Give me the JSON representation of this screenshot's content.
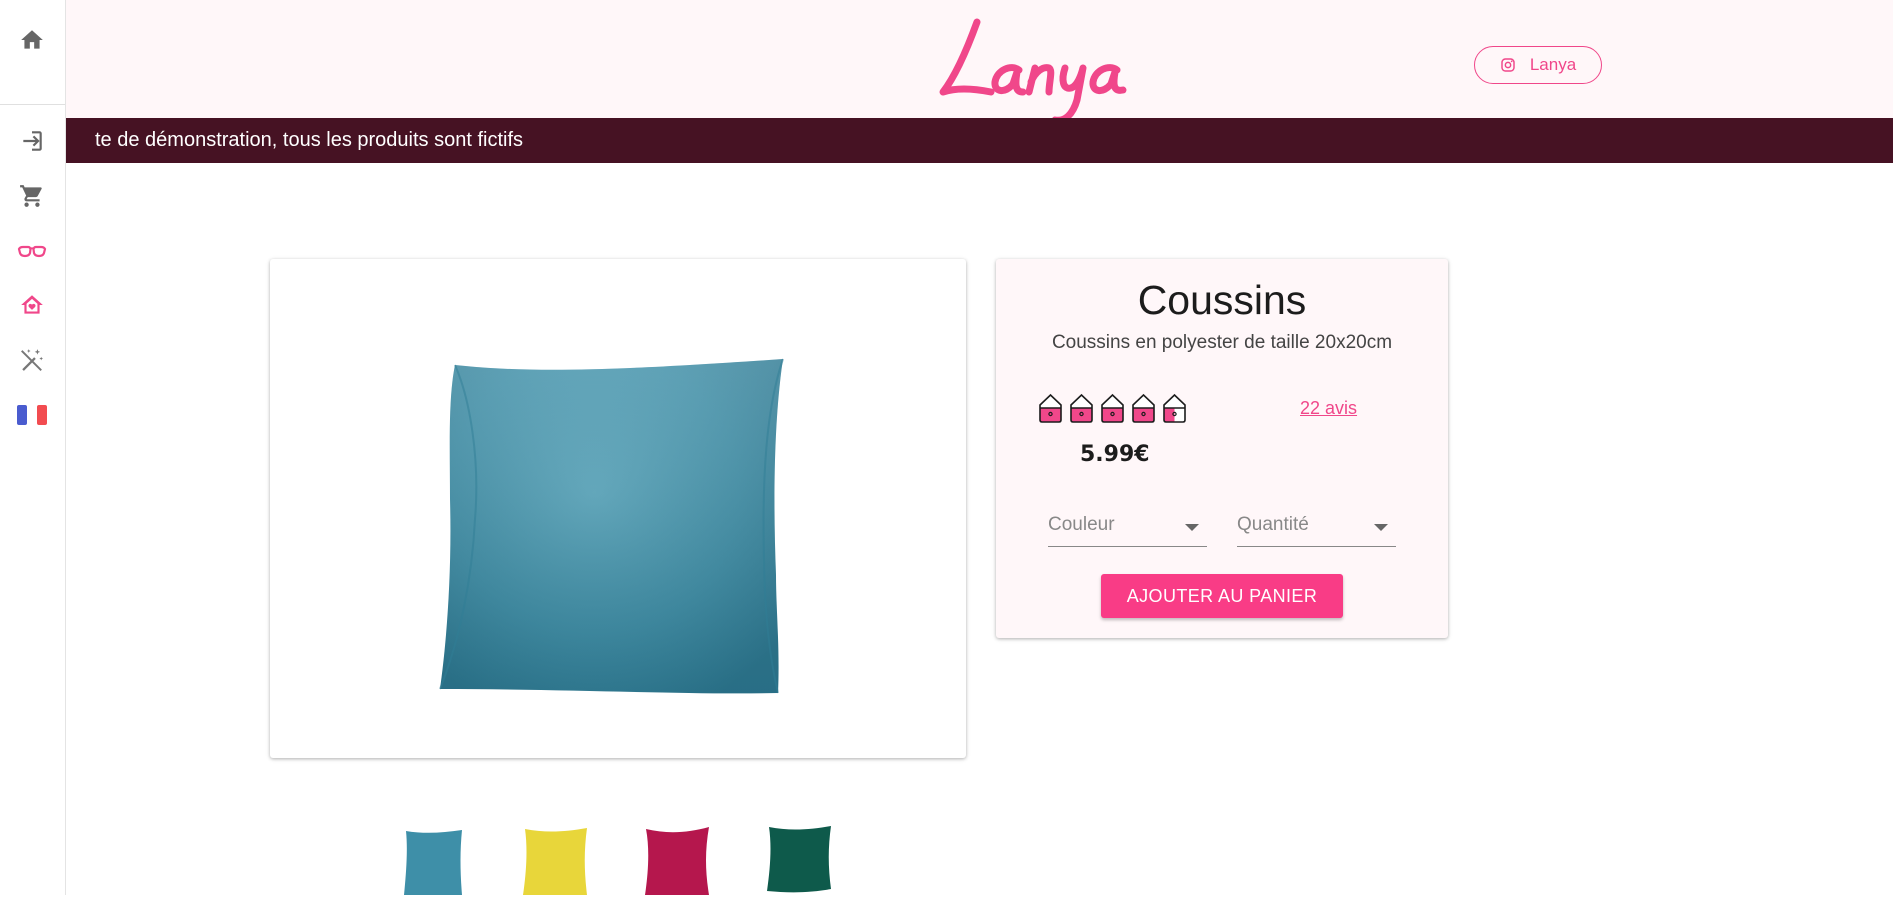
{
  "sidebar": {
    "items": [
      {
        "icon": "home-icon"
      },
      {
        "icon": "login-icon"
      },
      {
        "icon": "cart-icon"
      },
      {
        "icon": "glasses-icon"
      },
      {
        "icon": "house-heart-icon"
      },
      {
        "icon": "magic-off-icon"
      },
      {
        "icon": "flag-france-icon"
      }
    ]
  },
  "header": {
    "logo_text": "Lanya",
    "instagram_label": "Lanya",
    "brand_color": "#f0478a"
  },
  "banner": {
    "text": "te de démonstration, tous les produits sont fictifs",
    "background": "#461223"
  },
  "product": {
    "title": "Coussins",
    "description": "Coussins en polyester de taille 20x20cm",
    "rating": 4.5,
    "rating_max": 5,
    "reviews_label": "22 avis",
    "price": "5.99€",
    "color_select_placeholder": "Couleur",
    "quantity_select_placeholder": "Quantité",
    "add_to_cart_label": "AJOUTER AU PANIER",
    "thumbnails": [
      {
        "color": "#3e8fa8"
      },
      {
        "color": "#e8d63a"
      },
      {
        "color": "#b5174d"
      },
      {
        "color": "#0e5a4b"
      }
    ]
  }
}
